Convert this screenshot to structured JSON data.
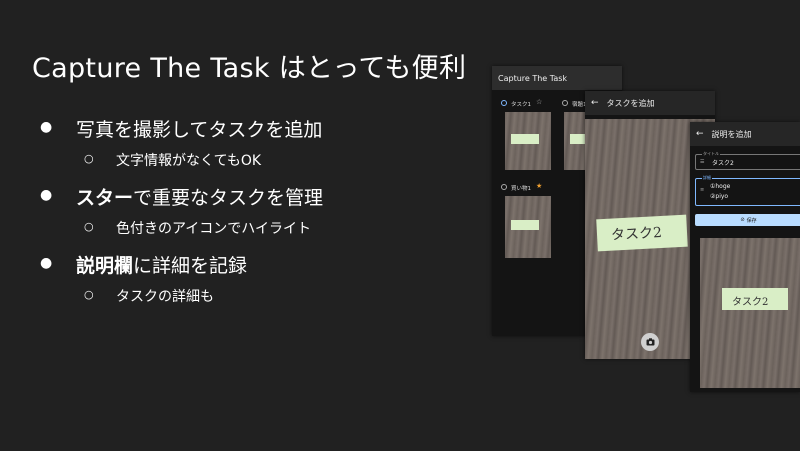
{
  "slide": {
    "title": "Capture The Task はとっても便利",
    "bullets": [
      {
        "text": "写真を撮影してタスクを追加",
        "sub": "文字情報がなくてもOK"
      },
      {
        "bold": "スター",
        "text": "で重要なタスクを管理",
        "sub": "色付きのアイコンでハイライト"
      },
      {
        "bold": "説明欄",
        "text": "に詳細を記録",
        "sub": "タスクの詳細も"
      }
    ]
  },
  "screen_list": {
    "app_title": "Capture The Task",
    "tasks": [
      {
        "title": "タスク1",
        "checked": true,
        "starred": false,
        "note": ""
      },
      {
        "title": "宿題1",
        "checked": false,
        "starred": false,
        "note": ""
      },
      {
        "title": "買い物1",
        "checked": false,
        "starred": true,
        "note": ""
      }
    ]
  },
  "screen_add": {
    "title": "タスクを追加",
    "note_text": "タスク2"
  },
  "screen_desc": {
    "title": "説明を追加",
    "title_field_label": "タイトル",
    "title_field_value": "タスク2",
    "detail_field_label": "詳細",
    "detail_line1": "①hoge",
    "detail_line2": "②piyo",
    "save_label": "保存",
    "note_text": "タスク2"
  },
  "colors": {
    "background": "#212121",
    "accent": "#b9dcff",
    "star": "#f0a030"
  }
}
